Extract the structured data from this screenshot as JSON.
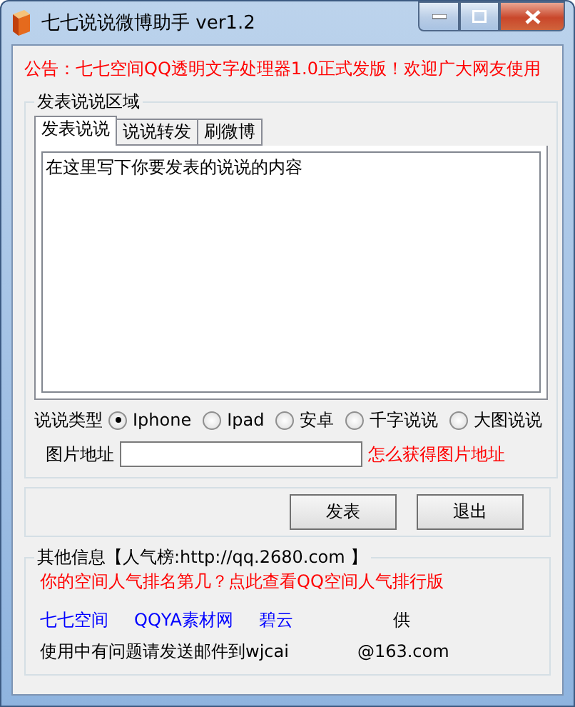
{
  "window": {
    "title": "七七说说微博助手 ver1.2"
  },
  "notice": "公告：七七空间QQ透明文字处理器1.0正式发版！欢迎广大网友使用",
  "publish_group": {
    "title": "发表说说区域",
    "tabs": [
      {
        "label": "发表说说",
        "selected": true
      },
      {
        "label": "说说转发",
        "selected": false
      },
      {
        "label": "刷微博",
        "selected": false
      }
    ],
    "content": "在这里写下你要发表的说说的内容",
    "type_label": "说说类型",
    "types": [
      {
        "label": "Iphone",
        "selected": true
      },
      {
        "label": "Ipad",
        "selected": false
      },
      {
        "label": "安卓",
        "selected": false
      },
      {
        "label": "千字说说",
        "selected": false
      },
      {
        "label": "大图说说",
        "selected": false
      }
    ],
    "image_label": "图片地址",
    "image_help_link": "怎么获得图片地址"
  },
  "buttons": [
    "发表",
    "退出"
  ],
  "info_group": {
    "title": "其他信息【人气榜:http://qq.2680.com 】",
    "rank_link": "你的空间人气排名第几？点此查看QQ空间人气排行版",
    "links": [
      "七七空间",
      "QQYA素材网",
      "碧云"
    ],
    "provider_text": "供",
    "contact": "使用中有问题请发送邮件到wjcai",
    "contact_tail": "@163.com"
  }
}
